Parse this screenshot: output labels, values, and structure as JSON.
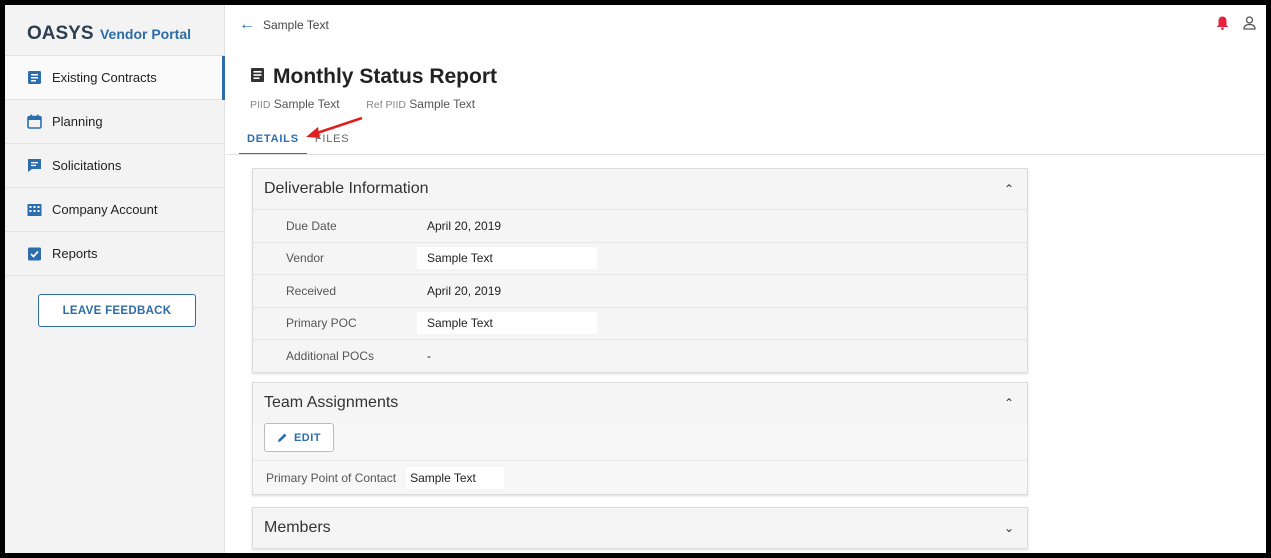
{
  "brand": {
    "name": "OASYS",
    "suffix": "Vendor Portal"
  },
  "sidebar": {
    "items": [
      {
        "label": "Existing Contracts",
        "icon": "contract-icon",
        "active": true
      },
      {
        "label": "Planning",
        "icon": "calendar-icon",
        "active": false
      },
      {
        "label": "Solicitations",
        "icon": "message-icon",
        "active": false
      },
      {
        "label": "Company Account",
        "icon": "building-icon",
        "active": false
      },
      {
        "label": "Reports",
        "icon": "clipboard-check-icon",
        "active": false
      }
    ],
    "feedback_label": "LEAVE FEEDBACK"
  },
  "topbar": {
    "back_label": "Sample Text"
  },
  "page": {
    "title": "Monthly Status Report",
    "piid_label": "PIID",
    "piid_value": "Sample Text",
    "ref_piid_label": "Ref PIID",
    "ref_piid_value": "Sample Text"
  },
  "tabs": [
    {
      "label": "DETAILS",
      "active": true
    },
    {
      "label": "FILES",
      "active": false
    }
  ],
  "deliverable": {
    "title": "Deliverable Information",
    "rows": [
      {
        "key": "Due Date",
        "value": "April 20, 2019"
      },
      {
        "key": "Vendor",
        "value": "Sample Text"
      },
      {
        "key": "Received",
        "value": "April 20, 2019"
      },
      {
        "key": "Primary POC",
        "value": "Sample Text"
      },
      {
        "key": "Additional POCs",
        "value": "-"
      }
    ]
  },
  "team": {
    "title": "Team Assignments",
    "edit_label": "EDIT",
    "poc_label": "Primary Point of Contact",
    "poc_value": "Sample Text"
  },
  "members": {
    "title": "Members"
  },
  "colors": {
    "accent": "#2b6dad",
    "alert": "#e4213f",
    "annotation": "#e02020"
  }
}
